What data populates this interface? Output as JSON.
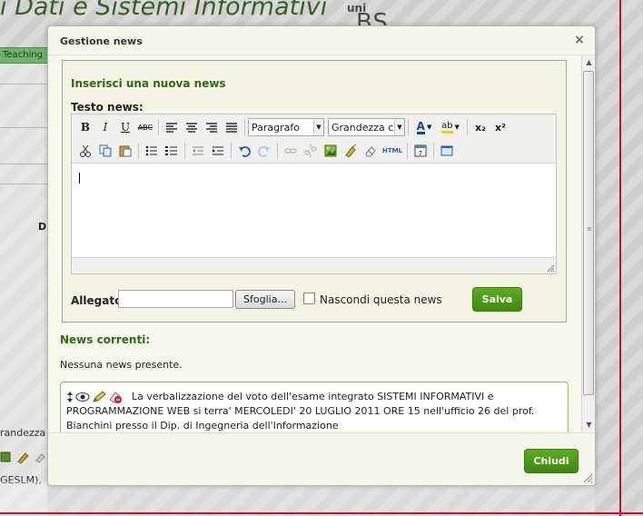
{
  "background": {
    "site_title": "i Dati e Sistemi Informativi",
    "logo_top": "uni",
    "logo_bottom": "BS",
    "teaching_tab": "Teaching",
    "side_letter": "D",
    "grandezza_fragment": "randezza c",
    "geslm_fragment": "GESLM),"
  },
  "dialog": {
    "title": "Gestione news",
    "close_glyph": "×",
    "form": {
      "heading": "Inserisci una nuova news",
      "text_label": "Testo news:",
      "format_select": "Paragrafo",
      "size_select": "Grandezza cara",
      "attachment_label": "Allegato:",
      "attachment_value": "",
      "browse_button": "Sfoglia...",
      "hide_label": "Nascondi questa news",
      "hide_checked": false,
      "save_button": "Salva"
    },
    "current": {
      "heading": "News correnti:",
      "empty_text": "Nessuna news presente.",
      "item_text": "La verbalizzazione del voto dell'esame integrato SISTEMI INFORMATIVI e PROGRAMMAZIONE WEB si terra' MERCOLEDI' 20 LUGLIO 2011 ORE 15 nell'ufficio 26 del prof. Bianchini presso il Dip. di Ingegneria dell'Informazione"
    },
    "footer": {
      "close_button": "Chiudi"
    }
  },
  "toolbar_icons": {
    "bold": "B",
    "italic": "I",
    "underline": "U",
    "strike": "ABC",
    "html": "HTML",
    "sub": "x₂",
    "sup": "x²",
    "text_color": "A",
    "highlight": "ab"
  },
  "colors": {
    "accent_green": "#3f8a0d",
    "heading_green": "#2f6b10",
    "frame_red": "#c8102e"
  }
}
